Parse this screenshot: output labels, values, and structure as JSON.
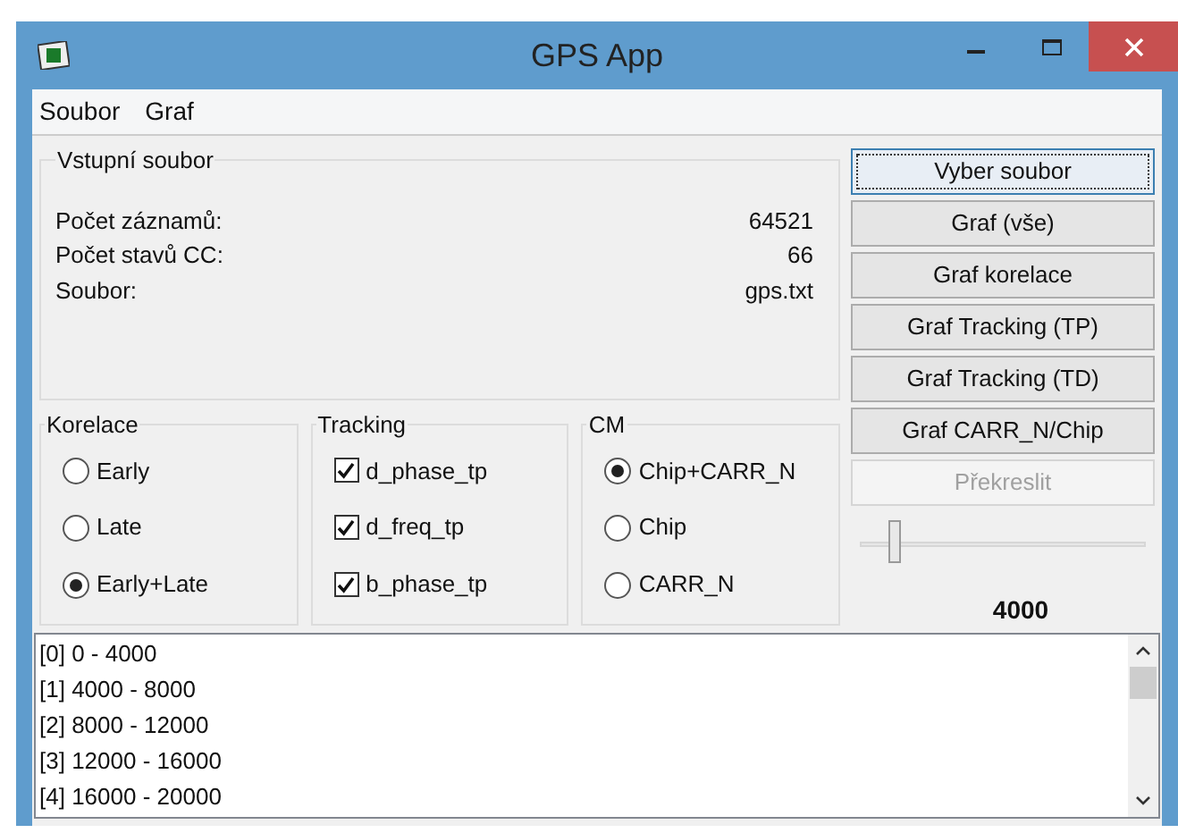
{
  "window": {
    "title": "GPS App"
  },
  "menu": [
    "Soubor",
    "Graf"
  ],
  "input_file": {
    "title": "Vstupní soubor",
    "rows": [
      {
        "label": "Počet záznamů:",
        "value": "64521"
      },
      {
        "label": "Počet stavů CC:",
        "value": "66"
      },
      {
        "label": "Soubor:",
        "value": "gps.txt"
      }
    ]
  },
  "groups": [
    {
      "title": "Korelace",
      "kind": "radio",
      "options": [
        {
          "label": "Early",
          "selected": false
        },
        {
          "label": "Late",
          "selected": false
        },
        {
          "label": "Early+Late",
          "selected": true
        }
      ]
    },
    {
      "title": "Tracking",
      "kind": "checkbox",
      "options": [
        {
          "label": "d_phase_tp",
          "checked": true
        },
        {
          "label": "d_freq_tp",
          "checked": true
        },
        {
          "label": "b_phase_tp",
          "checked": true
        }
      ]
    },
    {
      "title": "CM",
      "kind": "radio",
      "options": [
        {
          "label": "Chip+CARR_N",
          "selected": true
        },
        {
          "label": "Chip",
          "selected": false
        },
        {
          "label": "CARR_N",
          "selected": false
        }
      ]
    }
  ],
  "buttons": [
    {
      "label": "Vyber soubor",
      "disabled": false,
      "focused": true
    },
    {
      "label": "Graf (vše)",
      "disabled": false,
      "focused": false
    },
    {
      "label": "Graf korelace",
      "disabled": false,
      "focused": false
    },
    {
      "label": "Graf Tracking (TP)",
      "disabled": false,
      "focused": false
    },
    {
      "label": "Graf Tracking (TD)",
      "disabled": false,
      "focused": false
    },
    {
      "label": "Graf CARR_N/Chip",
      "disabled": false,
      "focused": false
    },
    {
      "label": "Překreslit",
      "disabled": true,
      "focused": false
    }
  ],
  "slider": {
    "level": 0.12,
    "reading": "4000"
  },
  "list": [
    "[0] 0 - 4000",
    "[1] 4000 - 8000",
    "[2] 8000 - 12000",
    "[3] 12000 - 16000",
    "[4] 16000 - 20000"
  ]
}
